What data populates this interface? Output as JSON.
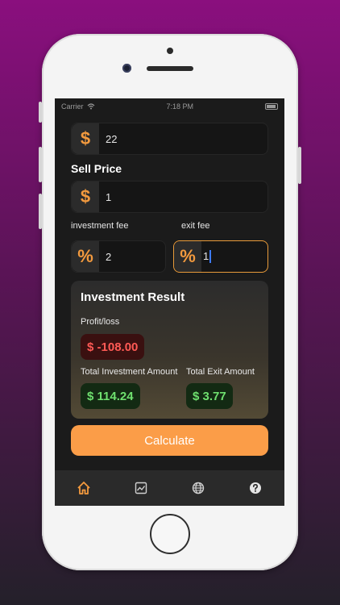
{
  "status": {
    "carrier": "Carrier",
    "time": "7:18 PM"
  },
  "buy": {
    "symbol": "$",
    "value": "22"
  },
  "sell": {
    "label": "Sell Price",
    "symbol": "$",
    "value": "1"
  },
  "fees": {
    "investment_label": "investment fee",
    "investment_symbol": "%",
    "investment_value": "2",
    "exit_label": "exit fee",
    "exit_symbol": "%",
    "exit_value": "1"
  },
  "result": {
    "title": "Investment Result",
    "profit_label": "Profit/loss",
    "profit_value": "$ -108.00",
    "total_investment_label": "Total Investment Amount",
    "total_investment_value": "$ 114.24",
    "total_exit_label": "Total Exit Amount",
    "total_exit_value": "$ 3.77"
  },
  "calculate_label": "Calculate",
  "tabs": [
    {
      "icon": "home-icon",
      "active": true
    },
    {
      "icon": "chart-icon",
      "active": false
    },
    {
      "icon": "globe-icon",
      "active": false
    },
    {
      "icon": "help-icon",
      "active": false
    }
  ],
  "colors": {
    "accent": "#fb9d48",
    "symbol": "#f39a3e",
    "loss": "#ff5a55",
    "gain": "#6fe06f",
    "tab_active": "#f39a3e",
    "tab_inactive": "#d0d0d0"
  }
}
